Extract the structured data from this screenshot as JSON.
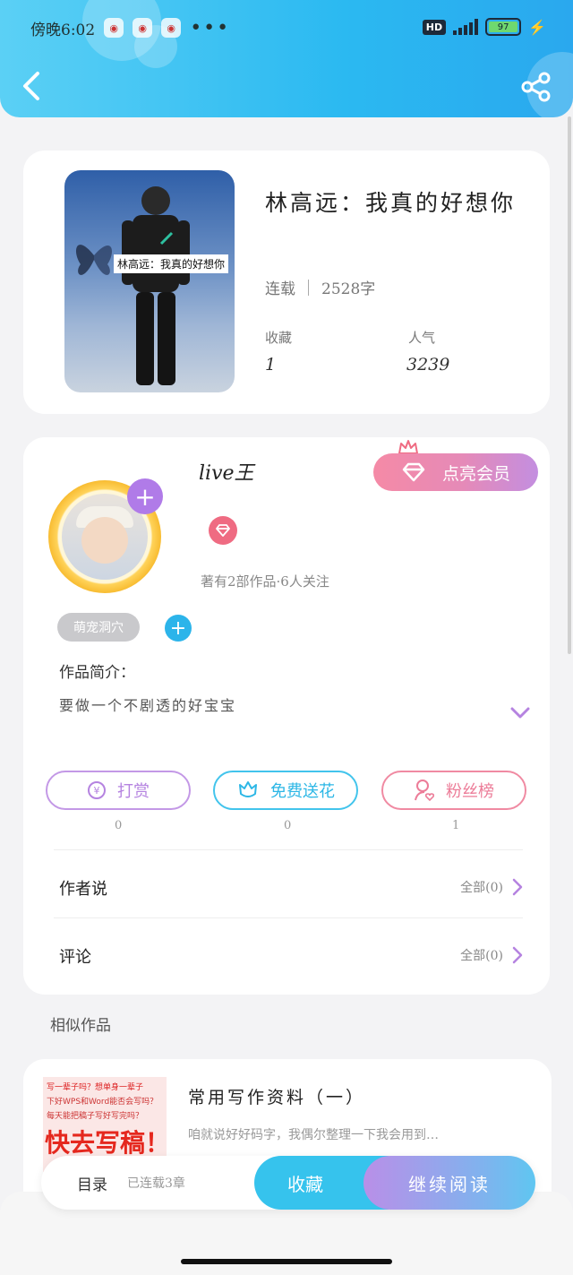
{
  "status_bar": {
    "time": "傍晚6:02",
    "dots": "•••",
    "hd": "HD",
    "battery": "97"
  },
  "book": {
    "title": "林高远：我真的好想你",
    "cover_caption": "林高远：我真的好想你",
    "serial_status": "连载",
    "word_count": "2528字",
    "favorites_label": "收藏",
    "favorites_value": "1",
    "popularity_label": "人气",
    "popularity_value": "3239"
  },
  "author": {
    "name": "live王",
    "vip_button": "点亮会员",
    "works_info": "著有2部作品·6人关注",
    "tag": "萌宠洞穴",
    "intro_label": "作品简介：",
    "intro_text": "要做一个不剧透的好宝宝"
  },
  "actions": [
    {
      "label": "打赏",
      "count": "0"
    },
    {
      "label": "免费送花",
      "count": "0"
    },
    {
      "label": "粉丝榜",
      "count": "1"
    }
  ],
  "rows": {
    "author_says": {
      "label": "作者说",
      "right": "全部(0)"
    },
    "comments": {
      "label": "评论",
      "right": "全部(0)"
    }
  },
  "similar": {
    "heading": "相似作品",
    "item": {
      "title": "常用写作资料（一）",
      "desc": "咱就说好好码字，我偶尔整理一下我会用到…",
      "thumb_line1": "写一辈子吗？想单身一辈子",
      "thumb_line2": "下好WPS和Word能否会写吗？",
      "thumb_line3": "每天能把稿子写好写完吗？",
      "thumb_big": "快去写稿！！！"
    }
  },
  "bottom_bar": {
    "toc": "目录",
    "serial_info": "已连载3章",
    "favorite_button": "收藏",
    "continue_button": "继续阅读"
  },
  "colors": {
    "header_blue": "#2bb9f1",
    "accent_purple": "#b583e0",
    "accent_pink": "#ec7c98",
    "accent_cyan": "#2db7e6"
  }
}
